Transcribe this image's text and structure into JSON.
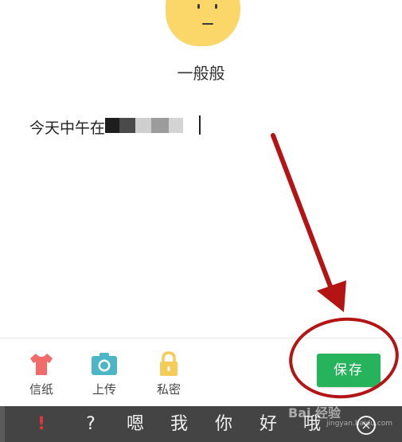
{
  "mood": {
    "icon": "neutral-face-icon",
    "label": "一般般"
  },
  "editor": {
    "text": "今天中午在"
  },
  "toolbar": {
    "items": [
      {
        "icon": "shirt-icon",
        "label": "信纸",
        "color": "#f26a6a"
      },
      {
        "icon": "camera-icon",
        "label": "上传",
        "color": "#4cb6c6"
      },
      {
        "icon": "lock-icon",
        "label": "私密",
        "color": "#f5cc5a"
      }
    ],
    "save_label": "保存"
  },
  "candidates": [
    "!",
    "?",
    "嗯",
    "我",
    "你",
    "好",
    "哦"
  ],
  "watermark": {
    "main": "Bai 经验",
    "sub": "jingyan.baidu.com"
  },
  "colors": {
    "save": "#27b35b",
    "annotation": "#b41414",
    "mood_face": "#fbd769"
  }
}
